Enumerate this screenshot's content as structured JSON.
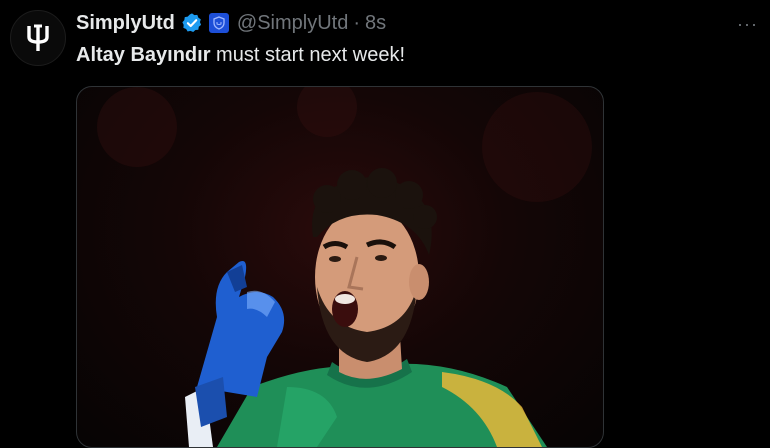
{
  "author": {
    "name": "SimplyUtd",
    "handle": "@SimplyUtd",
    "separator": "·",
    "time": "8s",
    "avatar_icon": "trident-icon",
    "verified_color": "#1d9bf0",
    "affiliate_color": "#1d4fd8"
  },
  "tweet": {
    "bold_text": "Altay Bayındır",
    "rest_text": " must start next week!"
  },
  "menu": {
    "more_label": "···"
  },
  "colors": {
    "background": "#000000",
    "text": "#e7e9ea",
    "muted": "#71767b",
    "kit": "#1f8f58"
  }
}
